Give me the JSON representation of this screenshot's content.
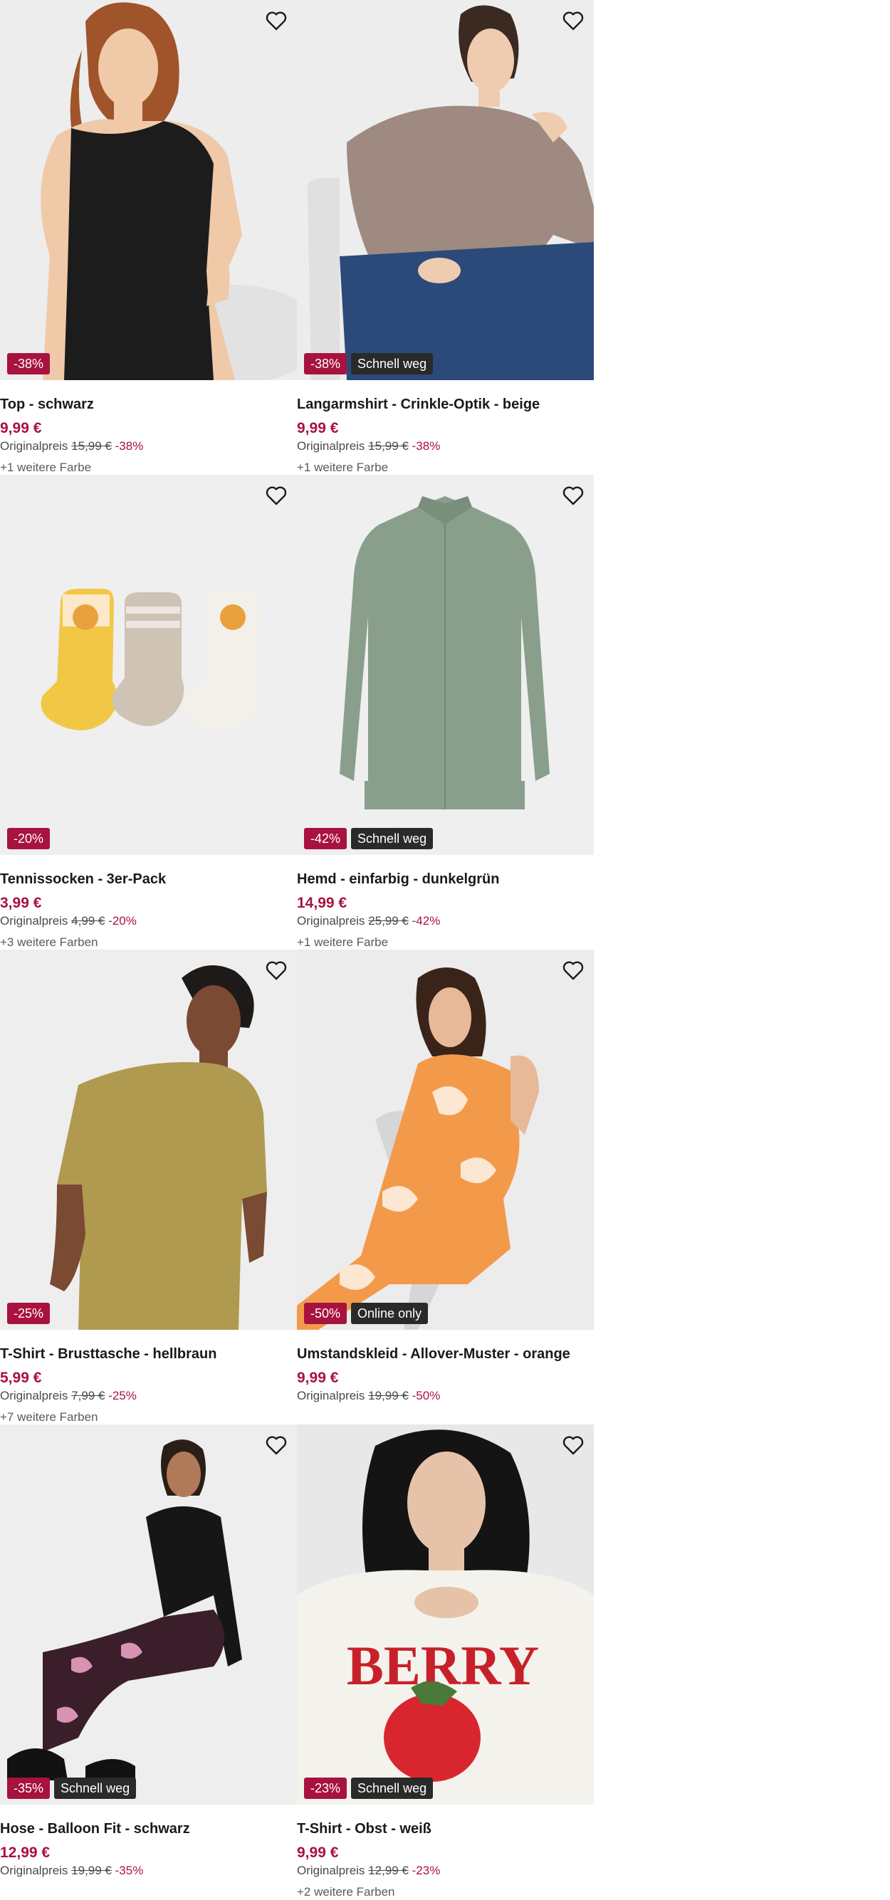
{
  "colors": {
    "discount": "#a8123e",
    "flag": "#2a2a2a",
    "price": "#a8123e"
  },
  "products": [
    {
      "title": "Top - schwarz",
      "price": "9,99 €",
      "orig_label": "Originalpreis",
      "orig_price": "15,99 €",
      "discount": "-38%",
      "flag": "",
      "more_colors": "+1 weitere Farbe",
      "image": "woman-black-sleeveless-top"
    },
    {
      "title": "Langarmshirt - Crinkle-Optik - beige",
      "price": "9,99 €",
      "orig_label": "Originalpreis",
      "orig_price": "15,99 €",
      "discount": "-38%",
      "flag": "Schnell weg",
      "more_colors": "+1 weitere Farbe",
      "image": "woman-beige-longsleeve"
    },
    {
      "title": "Tennissocken - 3er-Pack",
      "price": "3,99 €",
      "orig_label": "Originalpreis",
      "orig_price": "4,99 €",
      "discount": "-20%",
      "flag": "",
      "more_colors": "+3 weitere Farben",
      "image": "three-kids-socks"
    },
    {
      "title": "Hemd - einfarbig - dunkelgrün",
      "price": "14,99 €",
      "orig_label": "Originalpreis",
      "orig_price": "25,99 €",
      "discount": "-42%",
      "flag": "Schnell weg",
      "more_colors": "+1 weitere Farbe",
      "image": "green-shirt"
    },
    {
      "title": "T-Shirt - Brusttasche - hellbraun",
      "price": "5,99 €",
      "orig_label": "Originalpreis",
      "orig_price": "7,99 €",
      "discount": "-25%",
      "flag": "",
      "more_colors": "+7 weitere Farben",
      "image": "man-brown-tshirt"
    },
    {
      "title": "Umstandskleid - Allover-Muster - orange",
      "price": "9,99 €",
      "orig_label": "Originalpreis",
      "orig_price": "19,99 €",
      "discount": "-50%",
      "flag": "Online only",
      "more_colors": "",
      "image": "woman-orange-dress"
    },
    {
      "title": "Hose - Balloon Fit - schwarz",
      "price": "12,99 €",
      "orig_label": "Originalpreis",
      "orig_price": "19,99 €",
      "discount": "-35%",
      "flag": "Schnell weg",
      "more_colors": "",
      "image": "woman-patterned-pants"
    },
    {
      "title": "T-Shirt - Obst - weiß",
      "price": "9,99 €",
      "orig_label": "Originalpreis",
      "orig_price": "12,99 €",
      "discount": "-23%",
      "flag": "Schnell weg",
      "more_colors": "+2 weitere Farben",
      "image": "woman-berry-tshirt",
      "print_text": "BERRY"
    }
  ]
}
